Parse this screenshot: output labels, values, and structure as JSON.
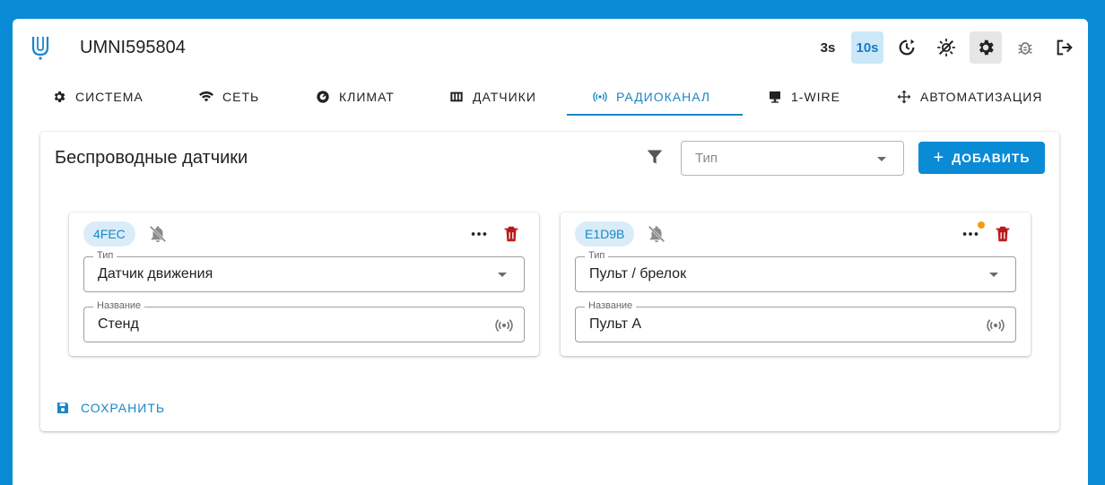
{
  "header": {
    "title": "UMNI595804",
    "interval_3s": "3s",
    "interval_10s": "10s"
  },
  "tabs": [
    {
      "label": "СИСТЕМА",
      "icon": "gear-icon"
    },
    {
      "label": "СЕТЬ",
      "icon": "wifi-icon"
    },
    {
      "label": "КЛИМАТ",
      "icon": "climate-icon"
    },
    {
      "label": "ДАТЧИКИ",
      "icon": "sensors-icon"
    },
    {
      "label": "РАДИОКАНАЛ",
      "icon": "radio-icon",
      "active": true
    },
    {
      "label": "1-WIRE",
      "icon": "one-wire-icon"
    },
    {
      "label": "АВТОМАТИЗАЦИЯ",
      "icon": "automation-icon"
    }
  ],
  "panel": {
    "title": "Беспроводные датчики",
    "type_filter_placeholder": "Тип",
    "add_label": "ДОБАВИТЬ",
    "save_label": "СОХРАНИТЬ"
  },
  "devices": [
    {
      "id": "4FEC",
      "type_label": "Тип",
      "type_value": "Датчик движения",
      "name_label": "Название",
      "name_value": "Стенд",
      "has_notification": false
    },
    {
      "id": "E1D9B",
      "type_label": "Тип",
      "type_value": "Пульт / брелок",
      "name_label": "Название",
      "name_value": "Пульт А",
      "has_notification": true
    }
  ],
  "colors": {
    "accent": "#0a8bd6",
    "active_tab": "#1a86c8",
    "delete": "#b71c1c",
    "notification": "#f39c12"
  }
}
